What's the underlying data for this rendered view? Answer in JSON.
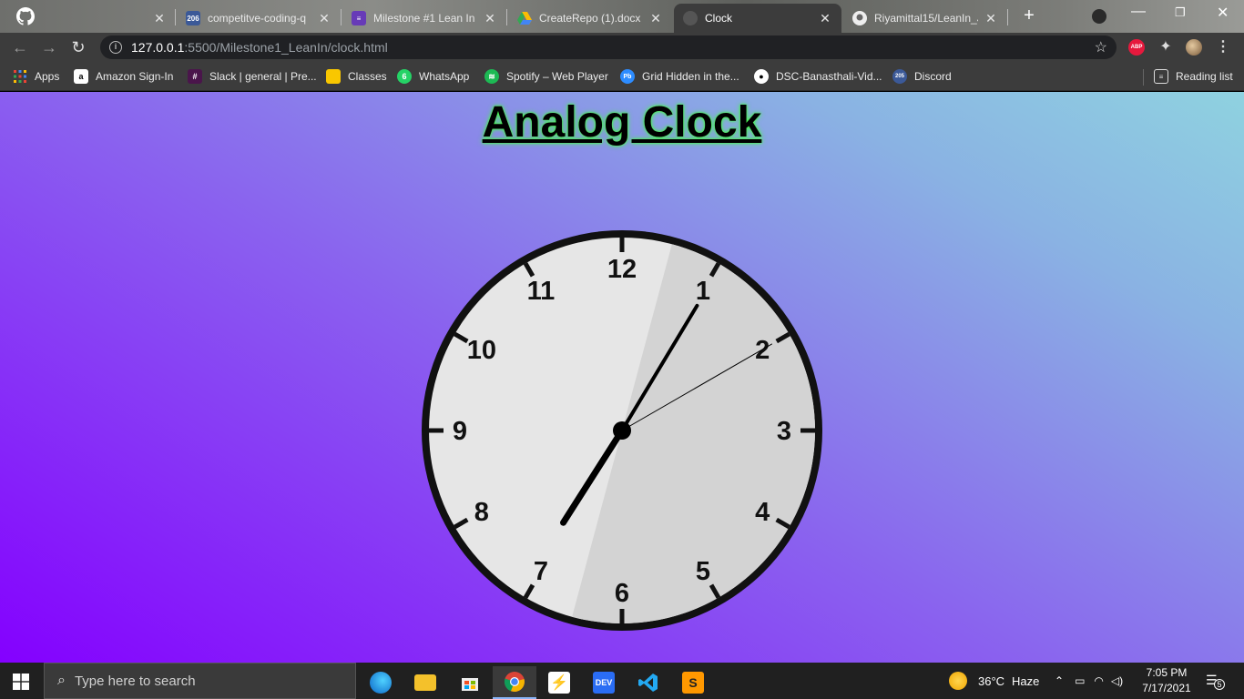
{
  "browser": {
    "tabs": [
      {
        "title": "",
        "favicon": "github-icon",
        "active": false
      },
      {
        "title": "competitve-coding-q",
        "favicon": "codeforces-206-icon",
        "badge": "206",
        "active": false
      },
      {
        "title": "Milestone #1 Lean In",
        "favicon": "forms-icon",
        "active": false
      },
      {
        "title": "CreateRepo (1).docx",
        "favicon": "google-drive-icon",
        "active": false
      },
      {
        "title": "Clock",
        "favicon": "globe-icon",
        "active": true
      },
      {
        "title": "Riyamittal15/LeanIn_J",
        "favicon": "github-icon",
        "active": false
      }
    ],
    "new_tab_label": "+",
    "address": {
      "host": "127.0.0.1",
      "path": ":5500/Milestone1_LeanIn/clock.html"
    },
    "extensions": {
      "abp_label": "ABP"
    },
    "bookmarks": [
      {
        "label": "Apps",
        "icon": "apps-grid-icon"
      },
      {
        "label": "Amazon Sign-In",
        "icon": "amazon-icon"
      },
      {
        "label": "Slack | general | Pre...",
        "icon": "slack-icon"
      },
      {
        "label": "Classes",
        "icon": "classroom-icon"
      },
      {
        "label": "WhatsApp",
        "icon": "whatsapp-icon",
        "badge": "6"
      },
      {
        "label": "Spotify – Web Player",
        "icon": "spotify-icon"
      },
      {
        "label": "Grid Hidden in the...",
        "icon": "pb-icon",
        "badge": "Pb"
      },
      {
        "label": "DSC-Banasthali-Vid...",
        "icon": "github-icon"
      },
      {
        "label": "Discord",
        "icon": "discord-205-icon",
        "badge": "205"
      }
    ],
    "reading_list_label": "Reading list"
  },
  "page": {
    "title": "Analog Clock",
    "clock": {
      "numbers": [
        "12",
        "1",
        "2",
        "3",
        "4",
        "5",
        "6",
        "7",
        "8",
        "9",
        "10",
        "11"
      ],
      "time": {
        "hour": 7,
        "minute": 5,
        "second": 10
      },
      "colors": {
        "face_light": "#e6e6e6",
        "face_shade": "#d3d3d3",
        "rim": "#111111",
        "hands": "#000000"
      }
    }
  },
  "taskbar": {
    "search_placeholder": "Type here to search",
    "apps": [
      {
        "name": "edge-icon",
        "label": "e"
      },
      {
        "name": "file-explorer-icon",
        "label": ""
      },
      {
        "name": "store-icon",
        "label": ""
      },
      {
        "name": "chrome-icon",
        "label": "",
        "active": true
      },
      {
        "name": "pulsar-icon",
        "label": ""
      },
      {
        "name": "dev-icon",
        "label": "DEV"
      },
      {
        "name": "vscode-icon",
        "label": ""
      },
      {
        "name": "sublime-icon",
        "label": "S"
      }
    ],
    "weather": {
      "temp": "36°C",
      "condition": "Haze"
    },
    "clock": {
      "time": "7:05 PM",
      "date": "7/17/2021"
    },
    "notifications_count": "5"
  }
}
